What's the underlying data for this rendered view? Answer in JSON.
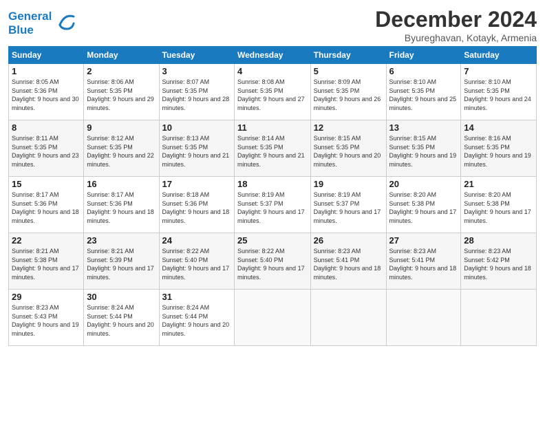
{
  "logo": {
    "line1": "General",
    "line2": "Blue"
  },
  "title": "December 2024",
  "subtitle": "Byureghavan, Kotayk, Armenia",
  "days_header": [
    "Sunday",
    "Monday",
    "Tuesday",
    "Wednesday",
    "Thursday",
    "Friday",
    "Saturday"
  ],
  "weeks": [
    [
      {
        "day": "1",
        "sunrise": "8:05 AM",
        "sunset": "5:36 PM",
        "daylight": "9 hours and 30 minutes."
      },
      {
        "day": "2",
        "sunrise": "8:06 AM",
        "sunset": "5:35 PM",
        "daylight": "9 hours and 29 minutes."
      },
      {
        "day": "3",
        "sunrise": "8:07 AM",
        "sunset": "5:35 PM",
        "daylight": "9 hours and 28 minutes."
      },
      {
        "day": "4",
        "sunrise": "8:08 AM",
        "sunset": "5:35 PM",
        "daylight": "9 hours and 27 minutes."
      },
      {
        "day": "5",
        "sunrise": "8:09 AM",
        "sunset": "5:35 PM",
        "daylight": "9 hours and 26 minutes."
      },
      {
        "day": "6",
        "sunrise": "8:10 AM",
        "sunset": "5:35 PM",
        "daylight": "9 hours and 25 minutes."
      },
      {
        "day": "7",
        "sunrise": "8:10 AM",
        "sunset": "5:35 PM",
        "daylight": "9 hours and 24 minutes."
      }
    ],
    [
      {
        "day": "8",
        "sunrise": "8:11 AM",
        "sunset": "5:35 PM",
        "daylight": "9 hours and 23 minutes."
      },
      {
        "day": "9",
        "sunrise": "8:12 AM",
        "sunset": "5:35 PM",
        "daylight": "9 hours and 22 minutes."
      },
      {
        "day": "10",
        "sunrise": "8:13 AM",
        "sunset": "5:35 PM",
        "daylight": "9 hours and 21 minutes."
      },
      {
        "day": "11",
        "sunrise": "8:14 AM",
        "sunset": "5:35 PM",
        "daylight": "9 hours and 21 minutes."
      },
      {
        "day": "12",
        "sunrise": "8:15 AM",
        "sunset": "5:35 PM",
        "daylight": "9 hours and 20 minutes."
      },
      {
        "day": "13",
        "sunrise": "8:15 AM",
        "sunset": "5:35 PM",
        "daylight": "9 hours and 19 minutes."
      },
      {
        "day": "14",
        "sunrise": "8:16 AM",
        "sunset": "5:35 PM",
        "daylight": "9 hours and 19 minutes."
      }
    ],
    [
      {
        "day": "15",
        "sunrise": "8:17 AM",
        "sunset": "5:36 PM",
        "daylight": "9 hours and 18 minutes."
      },
      {
        "day": "16",
        "sunrise": "8:17 AM",
        "sunset": "5:36 PM",
        "daylight": "9 hours and 18 minutes."
      },
      {
        "day": "17",
        "sunrise": "8:18 AM",
        "sunset": "5:36 PM",
        "daylight": "9 hours and 18 minutes."
      },
      {
        "day": "18",
        "sunrise": "8:19 AM",
        "sunset": "5:37 PM",
        "daylight": "9 hours and 17 minutes."
      },
      {
        "day": "19",
        "sunrise": "8:19 AM",
        "sunset": "5:37 PM",
        "daylight": "9 hours and 17 minutes."
      },
      {
        "day": "20",
        "sunrise": "8:20 AM",
        "sunset": "5:38 PM",
        "daylight": "9 hours and 17 minutes."
      },
      {
        "day": "21",
        "sunrise": "8:20 AM",
        "sunset": "5:38 PM",
        "daylight": "9 hours and 17 minutes."
      }
    ],
    [
      {
        "day": "22",
        "sunrise": "8:21 AM",
        "sunset": "5:38 PM",
        "daylight": "9 hours and 17 minutes."
      },
      {
        "day": "23",
        "sunrise": "8:21 AM",
        "sunset": "5:39 PM",
        "daylight": "9 hours and 17 minutes."
      },
      {
        "day": "24",
        "sunrise": "8:22 AM",
        "sunset": "5:40 PM",
        "daylight": "9 hours and 17 minutes."
      },
      {
        "day": "25",
        "sunrise": "8:22 AM",
        "sunset": "5:40 PM",
        "daylight": "9 hours and 17 minutes."
      },
      {
        "day": "26",
        "sunrise": "8:23 AM",
        "sunset": "5:41 PM",
        "daylight": "9 hours and 18 minutes."
      },
      {
        "day": "27",
        "sunrise": "8:23 AM",
        "sunset": "5:41 PM",
        "daylight": "9 hours and 18 minutes."
      },
      {
        "day": "28",
        "sunrise": "8:23 AM",
        "sunset": "5:42 PM",
        "daylight": "9 hours and 18 minutes."
      }
    ],
    [
      {
        "day": "29",
        "sunrise": "8:23 AM",
        "sunset": "5:43 PM",
        "daylight": "9 hours and 19 minutes."
      },
      {
        "day": "30",
        "sunrise": "8:24 AM",
        "sunset": "5:44 PM",
        "daylight": "9 hours and 20 minutes."
      },
      {
        "day": "31",
        "sunrise": "8:24 AM",
        "sunset": "5:44 PM",
        "daylight": "9 hours and 20 minutes."
      },
      null,
      null,
      null,
      null
    ]
  ],
  "labels": {
    "sunrise": "Sunrise:",
    "sunset": "Sunset:",
    "daylight": "Daylight:"
  }
}
